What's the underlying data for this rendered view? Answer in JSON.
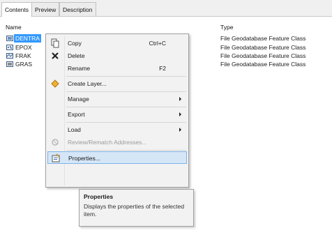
{
  "tabs": [
    {
      "label": "Contents",
      "active": true
    },
    {
      "label": "Preview",
      "active": false
    },
    {
      "label": "Description",
      "active": false
    }
  ],
  "columns": {
    "name": "Name",
    "type": "Type"
  },
  "rows": [
    {
      "name": "DENTRA",
      "type": "File Geodatabase Feature Class",
      "icon": "polygon-feature-class-icon",
      "selected": true
    },
    {
      "name": "EPOX",
      "type": "File Geodatabase Feature Class",
      "icon": "point-feature-class-icon",
      "selected": false
    },
    {
      "name": "FRAK",
      "type": "File Geodatabase Feature Class",
      "icon": "line-feature-class-icon",
      "selected": false
    },
    {
      "name": "GRAS",
      "type": "File Geodatabase Feature Class",
      "icon": "polygon-feature-class-icon",
      "selected": false
    }
  ],
  "context_menu": {
    "items": [
      {
        "label": "Copy",
        "shortcut": "Ctrl+C",
        "icon": "copy-icon"
      },
      {
        "label": "Delete",
        "shortcut": "",
        "icon": "delete-icon"
      },
      {
        "label": "Rename",
        "shortcut": "F2",
        "icon": ""
      },
      {
        "label": "Create Layer...",
        "shortcut": "",
        "icon": "create-layer-icon"
      },
      {
        "label": "Manage",
        "submenu": true
      },
      {
        "label": "Export",
        "submenu": true
      },
      {
        "label": "Load",
        "submenu": true
      },
      {
        "label": "Review/Rematch Addresses...",
        "disabled": true,
        "icon": "review-rematch-icon"
      },
      {
        "label": "Properties...",
        "highlighted": true,
        "icon": "properties-icon"
      }
    ]
  },
  "tooltip": {
    "title": "Properties",
    "body": "Displays the properties of the selected item."
  },
  "colors": {
    "selection": "#3399ff",
    "menu_background": "#f2f2f2",
    "menu_highlight": "#d5e6f7",
    "menu_highlight_border": "#7fb2e6"
  }
}
